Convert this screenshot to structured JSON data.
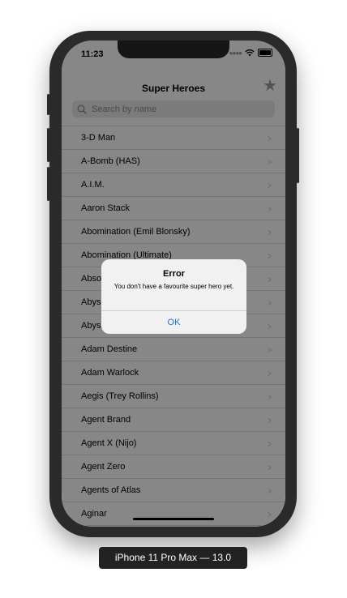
{
  "status": {
    "time": "11:23"
  },
  "nav": {
    "title": "Super Heroes",
    "favourite_icon": "star-icon"
  },
  "search": {
    "placeholder": "Search by name",
    "value": ""
  },
  "list": {
    "items": [
      "3-D Man",
      "A-Bomb (HAS)",
      "A.I.M.",
      "Aaron Stack",
      "Abomination (Emil Blonsky)",
      "Abomination (Ultimate)",
      "Absorbing Man",
      "Abyss",
      "Abyss (Age of Apocalypse)",
      "Adam Destine",
      "Adam Warlock",
      "Aegis (Trey Rollins)",
      "Agent Brand",
      "Agent X (Nijo)",
      "Agent Zero",
      "Agents of Atlas",
      "Aginar"
    ]
  },
  "alert": {
    "title": "Error",
    "message": "You don't have a favourite super hero yet.",
    "ok_label": "OK"
  },
  "simulator": {
    "caption": "iPhone 11 Pro Max — 13.0"
  },
  "colors": {
    "alert_button": "#1a73e8",
    "dim_overlay": "rgba(0,0,0,0.47)"
  }
}
